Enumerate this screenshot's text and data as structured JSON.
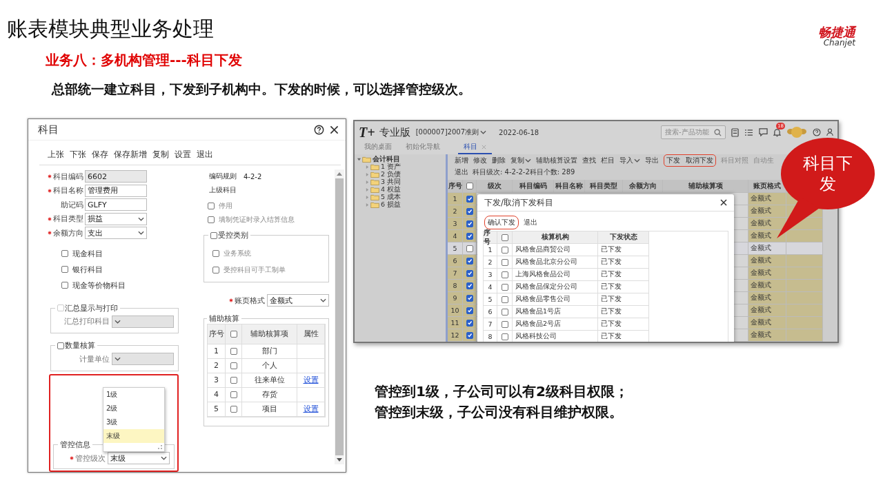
{
  "slide": {
    "title": "账表模块典型业务处理",
    "subtitle": "业务八：多机构管理---科目下发",
    "intro": "总部统一建立科目，下发到子机构中。下发的时候，可以选择管控级次。",
    "logo": {
      "name": "畅捷通",
      "sub": "Chanjet"
    },
    "callout": "科目下发",
    "notes": [
      "管控到1级，子公司可以有2级科目权限；",
      "管控到末级，子公司没有科目维护权限。"
    ]
  },
  "account_dialog": {
    "title": "科目",
    "toolbar": [
      "上张",
      "下张",
      "保存",
      "保存新增",
      "复制",
      "设置",
      "退出"
    ],
    "fields": [
      {
        "label": "科目编码",
        "required": true,
        "kind": "readonly",
        "value": "6602"
      },
      {
        "label": "科目名称",
        "required": true,
        "kind": "text",
        "value": "管理费用"
      },
      {
        "label": "助记码",
        "required": false,
        "kind": "text",
        "value": "GLFY"
      },
      {
        "label": "科目类型",
        "required": true,
        "kind": "select",
        "value": "损益"
      },
      {
        "label": "余额方向",
        "required": true,
        "kind": "select",
        "value": "支出"
      }
    ],
    "account_flags": [
      {
        "label": "现金科目",
        "checked": false
      },
      {
        "label": "银行科目",
        "checked": false
      },
      {
        "label": "现金等价物科目",
        "checked": false
      }
    ],
    "code_rule": {
      "label": "编码规则",
      "value": "4-2-2"
    },
    "parent_account": {
      "label": "上级科目"
    },
    "options": [
      {
        "label": "停用",
        "checked": false,
        "disabled": true
      },
      {
        "label": "填制凭证时录入结算信息",
        "checked": false,
        "disabled": true
      }
    ],
    "controlled_category": {
      "label": "受控类别",
      "checked": false,
      "items": [
        {
          "label": "业务系统",
          "checked": false,
          "disabled": true
        },
        {
          "label": "受控科目可手工制单",
          "checked": false,
          "disabled": true
        }
      ]
    },
    "summary_print": {
      "label": "汇总显示与打印",
      "checked": false,
      "field_label": "汇总打印科目"
    },
    "quantity": {
      "label": "数量核算",
      "checked": false,
      "field_label": "计量单位"
    },
    "ledger_format": {
      "label": "账页格式",
      "required": true,
      "value": "金额式"
    },
    "auxiliary": {
      "label": "辅助核算",
      "select_all_checked": false,
      "columns": [
        "序号",
        "辅助核算项",
        "属性"
      ],
      "rows": [
        {
          "no": "1",
          "checked": false,
          "item": "部门"
        },
        {
          "no": "2",
          "checked": false,
          "item": "个人"
        },
        {
          "no": "3",
          "checked": false,
          "item": "往来单位",
          "link": "设置"
        },
        {
          "no": "4",
          "checked": false,
          "item": "存货"
        },
        {
          "no": "5",
          "checked": false,
          "item": "项目",
          "link": "设置"
        }
      ]
    },
    "control": {
      "group_label": "管控信息",
      "label": "管控级次",
      "required": true,
      "value": "末级",
      "dropdown": [
        {
          "label": "1级",
          "selected": false
        },
        {
          "label": "2级",
          "selected": false
        },
        {
          "label": "3级",
          "selected": false
        },
        {
          "label": "末级",
          "selected": true
        }
      ]
    }
  },
  "tplus_app": {
    "logo": "T+",
    "edition": "专业版",
    "account_set": "[000007]2007准则",
    "date": "2022-06-18",
    "search": {
      "placeholder": "搜索-产品功能"
    },
    "notification_count": "18",
    "tabs": [
      {
        "label": "我的桌面",
        "selected": false
      },
      {
        "label": "初始化导航",
        "selected": false
      },
      {
        "label": "科目",
        "selected": true
      }
    ],
    "tree": {
      "label": "会计科目",
      "expanded": true,
      "children": [
        {
          "label": "1 资产"
        },
        {
          "label": "2 负债"
        },
        {
          "label": "3 共同"
        },
        {
          "label": "4 权益"
        },
        {
          "label": "5 成本"
        },
        {
          "label": "6 损益"
        }
      ]
    },
    "toolbar": [
      {
        "label": "新增",
        "menu": false,
        "highlighted": false
      },
      {
        "label": "修改",
        "menu": false,
        "highlighted": false
      },
      {
        "label": "删除",
        "menu": false,
        "highlighted": false
      },
      {
        "label": "复制",
        "menu": true,
        "highlighted": false
      },
      {
        "label": "辅助核算设置",
        "menu": false,
        "highlighted": false
      },
      {
        "label": "查找",
        "menu": false,
        "highlighted": false
      },
      {
        "label": "栏目",
        "menu": false,
        "highlighted": false
      },
      {
        "label": "导入",
        "menu": true,
        "highlighted": false
      },
      {
        "label": "导出",
        "menu": false,
        "highlighted": false
      },
      {
        "label": "下发",
        "menu": false,
        "highlighted": true
      },
      {
        "label": "取消下发",
        "menu": false,
        "highlighted": true
      },
      {
        "label": "科目对照",
        "menu": false,
        "highlighted": false
      },
      {
        "label": "自动生",
        "menu": false,
        "highlighted": false
      }
    ],
    "exit": "退出",
    "info": "科目级次:  4-2-2-2科目个数:  289",
    "select_all_checked": false,
    "columns": [
      "序号",
      "级次",
      "科目编码",
      "科目名称",
      "科目类型",
      "余额方向",
      "辅助核算项",
      "账页格式"
    ],
    "rows": [
      {
        "no": "1",
        "checked": true,
        "selected": false,
        "format": "金额式"
      },
      {
        "no": "2",
        "checked": true,
        "selected": false,
        "format": "金额式"
      },
      {
        "no": "3",
        "checked": true,
        "selected": false,
        "format": "金额式"
      },
      {
        "no": "4",
        "checked": true,
        "selected": false,
        "format": "金额式"
      },
      {
        "no": "5",
        "checked": false,
        "selected": true,
        "format": "金额式"
      },
      {
        "no": "6",
        "checked": true,
        "selected": false,
        "format": "金额式"
      },
      {
        "no": "7",
        "checked": true,
        "selected": false,
        "format": "金额式"
      },
      {
        "no": "8",
        "checked": true,
        "selected": false,
        "format": "金额式"
      },
      {
        "no": "9",
        "checked": true,
        "selected": false,
        "format": "金额式"
      },
      {
        "no": "10",
        "checked": true,
        "selected": false,
        "format": "金额式"
      },
      {
        "no": "11",
        "checked": true,
        "selected": false,
        "format": "金额式"
      },
      {
        "no": "12",
        "checked": true,
        "selected": false,
        "format": "金额式"
      }
    ],
    "modal": {
      "title": "下发/取消下发科目",
      "toolbar": [
        {
          "label": "确认下发",
          "highlighted": true
        },
        {
          "label": "退出",
          "highlighted": false
        }
      ],
      "select_all_checked": false,
      "columns": [
        "序号",
        "核算机构",
        "下发状态"
      ],
      "rows": [
        {
          "no": "1",
          "checked": false,
          "org": "风格食品商贸公司",
          "status": "已下发"
        },
        {
          "no": "2",
          "checked": false,
          "org": "风格食品北京分公司",
          "status": "已下发"
        },
        {
          "no": "3",
          "checked": false,
          "org": "上海风格食品公司",
          "status": "已下发"
        },
        {
          "no": "4",
          "checked": false,
          "org": "风格食品保定分公司",
          "status": "已下发"
        },
        {
          "no": "5",
          "checked": false,
          "org": "风格食品零售公司",
          "status": "已下发"
        },
        {
          "no": "6",
          "checked": false,
          "org": "风格食品1号店",
          "status": "已下发"
        },
        {
          "no": "7",
          "checked": false,
          "org": "风格食品2号店",
          "status": "已下发"
        },
        {
          "no": "8",
          "checked": false,
          "org": "风格科技公司",
          "status": "已下发"
        }
      ]
    }
  }
}
